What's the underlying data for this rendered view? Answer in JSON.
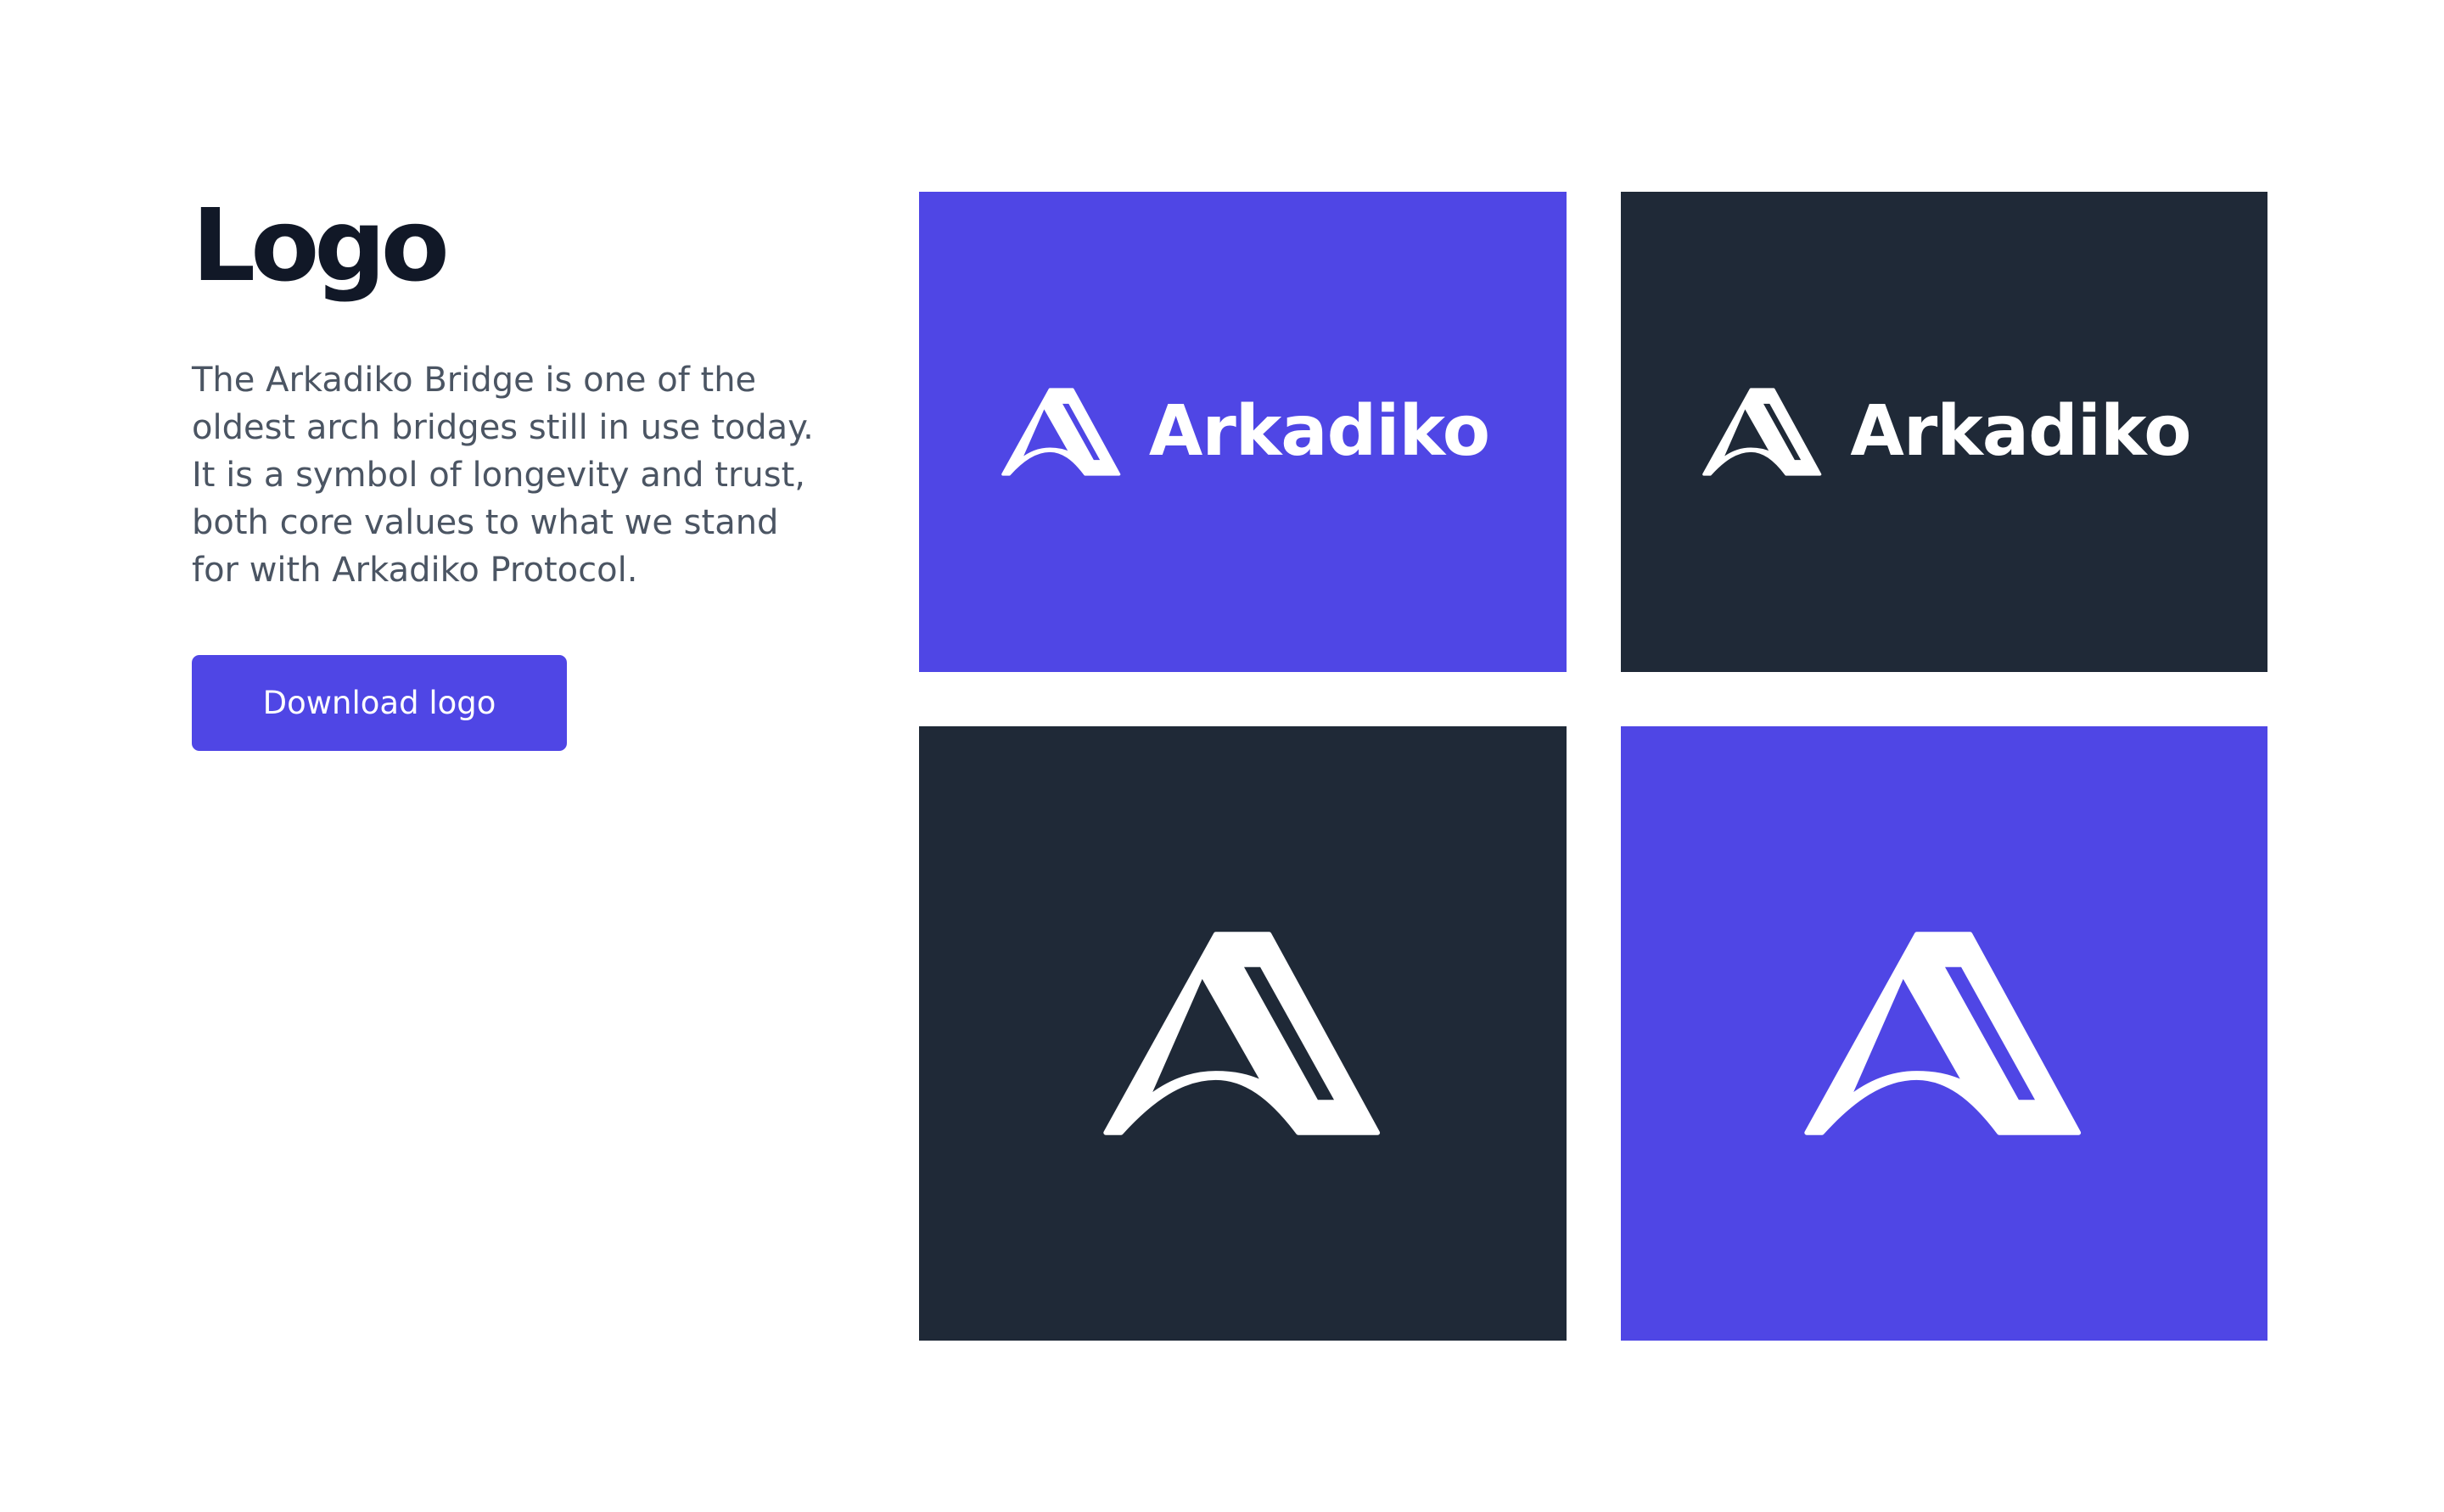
{
  "intro": {
    "title": "Logo",
    "description": "The Arkadiko Bridge is one of the oldest arch bridges still in use today. It is a symbol of longevity and trust, both core values to what we stand for with Arkadiko Protocol.",
    "download_label": "Download logo"
  },
  "tiles": [
    {
      "variant": "lockup",
      "background": "#4f46e5",
      "wordmark": "Arkadiko"
    },
    {
      "variant": "lockup",
      "background": "#1f2937",
      "wordmark": "Arkadiko"
    },
    {
      "variant": "mark",
      "background": "#1f2937"
    },
    {
      "variant": "mark",
      "background": "#4f46e5"
    }
  ],
  "colors": {
    "brand_indigo": "#4f46e5",
    "dark": "#1f2937",
    "title": "#111827",
    "body_text": "#4b5563",
    "logo": "#ffffff"
  },
  "icons": {
    "logo_mark": "arkadiko-arch-icon"
  }
}
